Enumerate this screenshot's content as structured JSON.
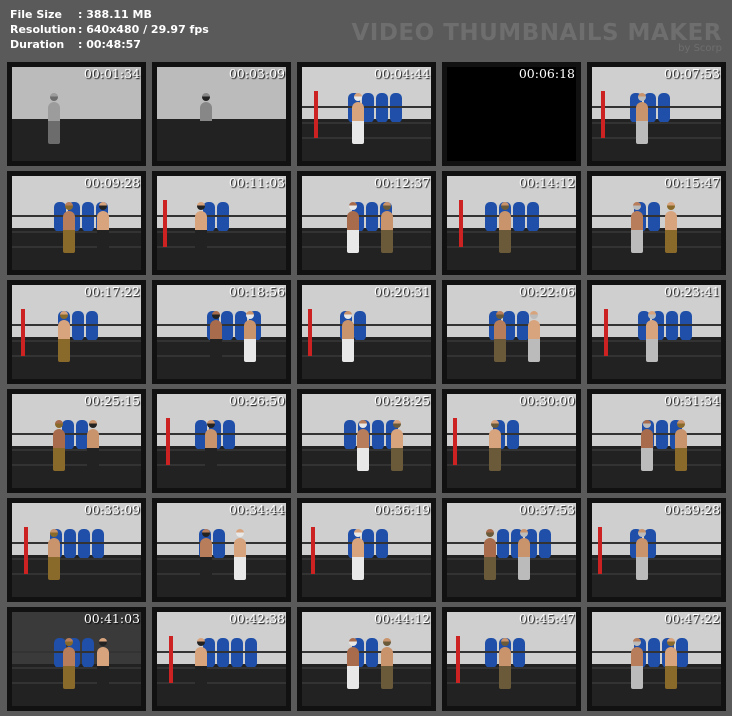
{
  "info": {
    "file_size_label": "File Size",
    "file_size_value": ": 388.11 MB",
    "resolution_label": "Resolution",
    "resolution_value": ": 640x480 / 29.97 fps",
    "duration_label": "Duration",
    "duration_value": ": 00:48:57"
  },
  "brand": {
    "title": "VIDEO THUMBNAILS MAKER",
    "subtitle": "by Scorp"
  },
  "thumbnails": [
    {
      "ts": "00:01:34",
      "style": "bw"
    },
    {
      "ts": "00:03:09",
      "style": "bw"
    },
    {
      "ts": "00:04:44",
      "style": "gym"
    },
    {
      "ts": "00:06:18",
      "style": "dark"
    },
    {
      "ts": "00:07:53",
      "style": "gym"
    },
    {
      "ts": "00:09:28",
      "style": "gym"
    },
    {
      "ts": "00:11:03",
      "style": "gym"
    },
    {
      "ts": "00:12:37",
      "style": "gym"
    },
    {
      "ts": "00:14:12",
      "style": "gym"
    },
    {
      "ts": "00:15:47",
      "style": "gym"
    },
    {
      "ts": "00:17:22",
      "style": "gym"
    },
    {
      "ts": "00:18:56",
      "style": "gym"
    },
    {
      "ts": "00:20:31",
      "style": "gym"
    },
    {
      "ts": "00:22:06",
      "style": "gym"
    },
    {
      "ts": "00:23:41",
      "style": "gym"
    },
    {
      "ts": "00:25:15",
      "style": "gym"
    },
    {
      "ts": "00:26:50",
      "style": "gym"
    },
    {
      "ts": "00:28:25",
      "style": "gym"
    },
    {
      "ts": "00:30:00",
      "style": "gym"
    },
    {
      "ts": "00:31:34",
      "style": "gym"
    },
    {
      "ts": "00:33:09",
      "style": "gym"
    },
    {
      "ts": "00:34:44",
      "style": "gym"
    },
    {
      "ts": "00:36:19",
      "style": "gym"
    },
    {
      "ts": "00:37:53",
      "style": "gym"
    },
    {
      "ts": "00:39:28",
      "style": "gym"
    },
    {
      "ts": "00:41:03",
      "style": "dim"
    },
    {
      "ts": "00:42:38",
      "style": "gym"
    },
    {
      "ts": "00:44:12",
      "style": "gym"
    },
    {
      "ts": "00:45:47",
      "style": "gym"
    },
    {
      "ts": "00:47:22",
      "style": "gym"
    }
  ],
  "colors": {
    "background": "#5a5a5a",
    "bag_blue": "#1f4fa8",
    "post_red": "#cc2222"
  }
}
